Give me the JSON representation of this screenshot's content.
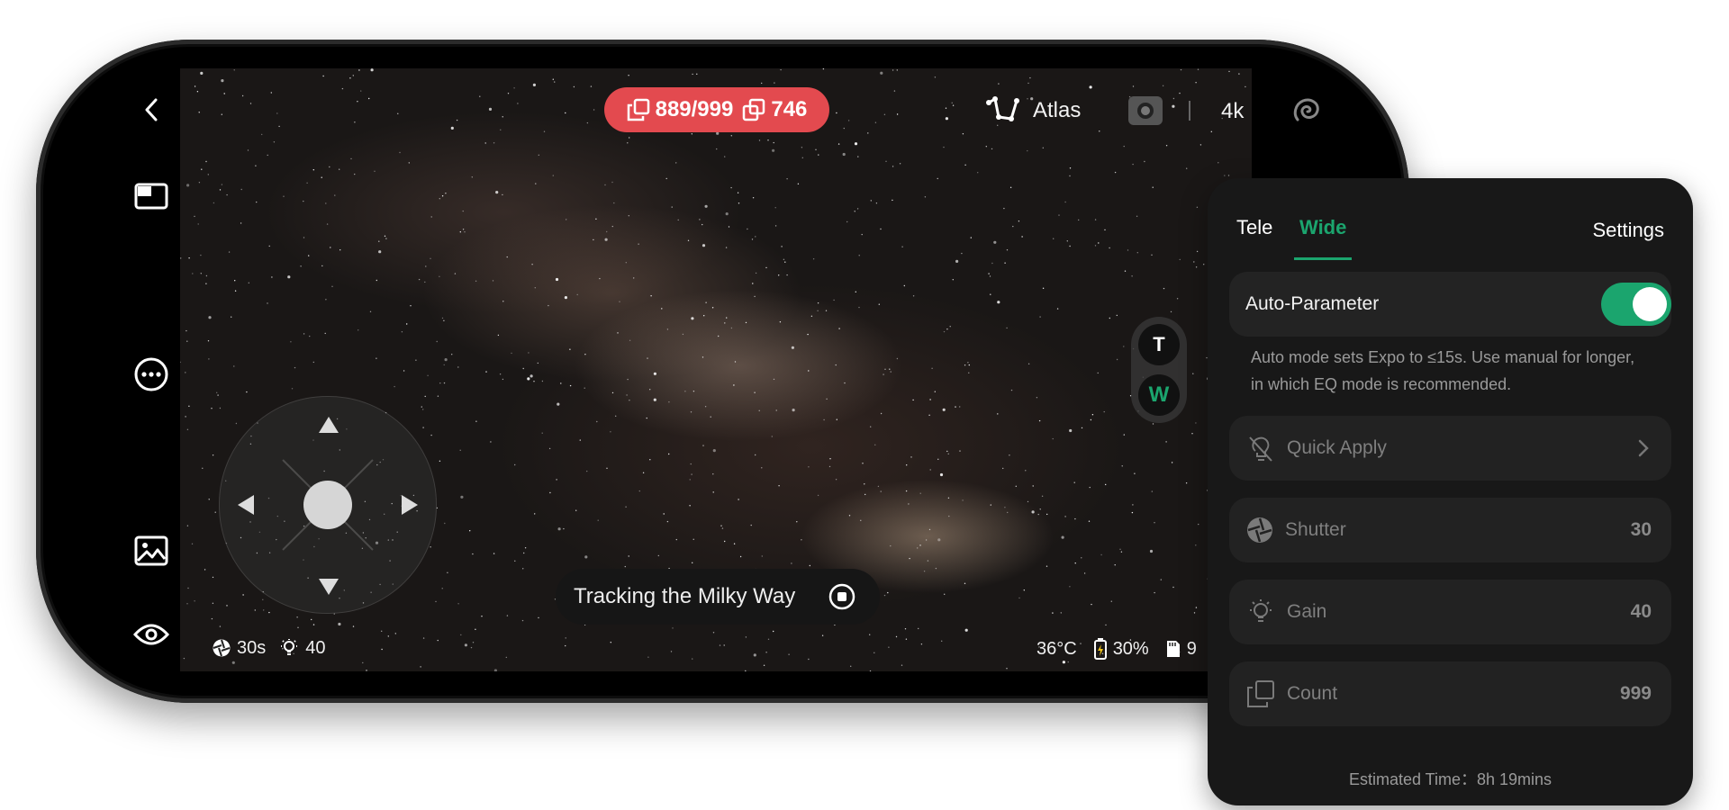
{
  "counter": {
    "frames": "889/999",
    "stacked": "746"
  },
  "topbar": {
    "mode_label": "Atlas",
    "resolution": "4k"
  },
  "tracking": {
    "label": "Tracking the Milky Way"
  },
  "status_left": {
    "exposure": "30s",
    "gain": "40"
  },
  "status_right": {
    "temperature": "36°C",
    "battery": "30%",
    "storage": "9"
  },
  "lens_switch": {
    "tele": "T",
    "wide": "W"
  },
  "panel": {
    "tabs": {
      "tele": "Tele",
      "wide": "Wide",
      "settings": "Settings"
    },
    "auto_parameter": {
      "label": "Auto-Parameter",
      "enabled": true
    },
    "auto_note": "Auto mode sets Expo to ≤15s. Use manual for longer, in which EQ mode is recommended.",
    "quick_apply": "Quick Apply",
    "rows": [
      {
        "label": "Shutter",
        "value": "30"
      },
      {
        "label": "Gain",
        "value": "40"
      },
      {
        "label": "Count",
        "value": "999"
      }
    ],
    "estimated_time": "Estimated Time：8h 19mins"
  },
  "colors": {
    "accent": "#1ba56e",
    "record_pill": "#e34a4f",
    "panel_bg": "#181818"
  },
  "icons": [
    "back-icon",
    "layout-icon",
    "more-icon",
    "gallery-icon",
    "eye-icon",
    "stack-icon",
    "constellation-icon",
    "camera-icon",
    "spiral-icon",
    "stop-icon",
    "aperture-icon",
    "bulb-icon",
    "battery-icon",
    "sd-card-icon",
    "chevron-right-icon"
  ]
}
